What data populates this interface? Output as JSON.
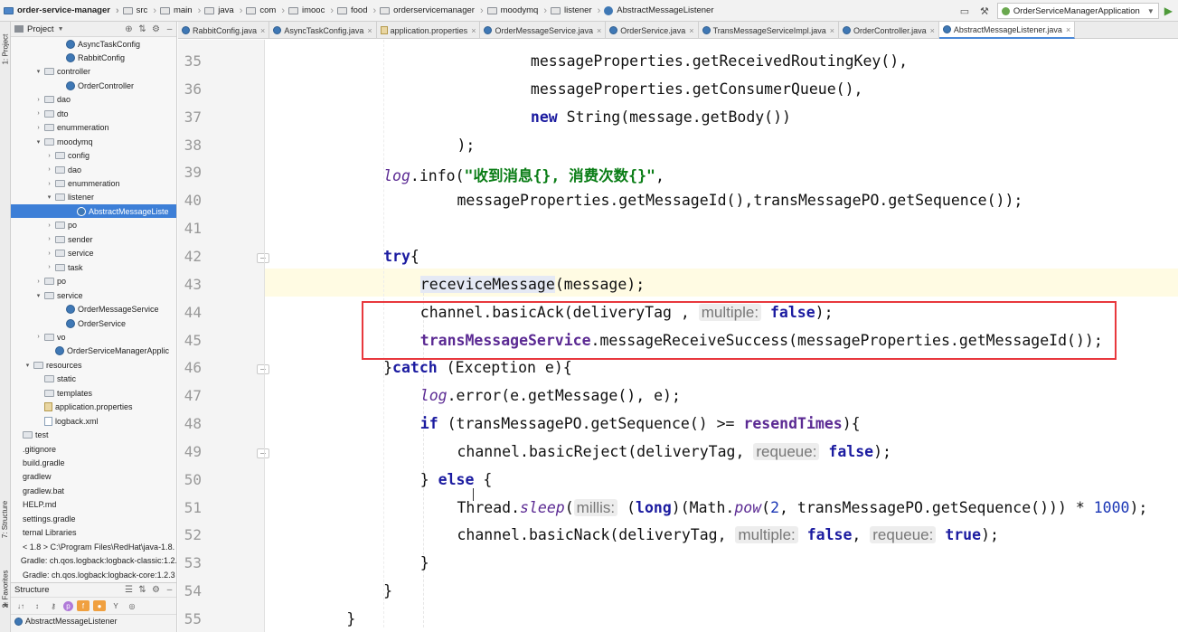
{
  "breadcrumb": [
    "order-service-manager",
    "src",
    "main",
    "java",
    "com",
    "imooc",
    "food",
    "orderservicemanager",
    "moodymq",
    "listener",
    "AbstractMessageListener"
  ],
  "run_config": "OrderServiceManagerApplication",
  "left_strip": {
    "project": "1: Project",
    "structure": "7: Structure",
    "favorites": "2: Favorites"
  },
  "project_panel": {
    "title": "Project",
    "tree": [
      {
        "label": "AsyncTaskConfig",
        "icon": "class",
        "indent": 4
      },
      {
        "label": "RabbitConfig",
        "icon": "class",
        "indent": 4
      },
      {
        "label": "controller",
        "icon": "folder",
        "arrow": "down",
        "indent": 2
      },
      {
        "label": "OrderController",
        "icon": "class",
        "indent": 4
      },
      {
        "label": "dao",
        "icon": "folder",
        "arrow": "right",
        "indent": 2
      },
      {
        "label": "dto",
        "icon": "folder",
        "arrow": "right",
        "indent": 2
      },
      {
        "label": "enummeration",
        "icon": "folder",
        "arrow": "right",
        "indent": 2
      },
      {
        "label": "moodymq",
        "icon": "folder",
        "arrow": "down",
        "indent": 2
      },
      {
        "label": "config",
        "icon": "folder",
        "arrow": "right",
        "indent": 3
      },
      {
        "label": "dao",
        "icon": "folder",
        "arrow": "right",
        "indent": 3
      },
      {
        "label": "enummeration",
        "icon": "folder",
        "arrow": "right",
        "indent": 3
      },
      {
        "label": "listener",
        "icon": "folder",
        "arrow": "down",
        "indent": 3
      },
      {
        "label": "AbstractMessageListe",
        "icon": "class",
        "indent": 5,
        "selected": true
      },
      {
        "label": "po",
        "icon": "folder",
        "arrow": "right",
        "indent": 3
      },
      {
        "label": "sender",
        "icon": "folder",
        "arrow": "right",
        "indent": 3
      },
      {
        "label": "service",
        "icon": "folder",
        "arrow": "right",
        "indent": 3
      },
      {
        "label": "task",
        "icon": "folder",
        "arrow": "right",
        "indent": 3
      },
      {
        "label": "po",
        "icon": "folder",
        "arrow": "right",
        "indent": 2
      },
      {
        "label": "service",
        "icon": "folder",
        "arrow": "down",
        "indent": 2
      },
      {
        "label": "OrderMessageService",
        "icon": "class",
        "indent": 4
      },
      {
        "label": "OrderService",
        "icon": "class",
        "indent": 4
      },
      {
        "label": "vo",
        "icon": "folder",
        "arrow": "right",
        "indent": 2
      },
      {
        "label": "OrderServiceManagerApplic",
        "icon": "class",
        "indent": 3
      },
      {
        "label": "resources",
        "icon": "folder",
        "arrow": "down",
        "indent": 1
      },
      {
        "label": "static",
        "icon": "folder",
        "indent": 2
      },
      {
        "label": "templates",
        "icon": "folder",
        "indent": 2
      },
      {
        "label": "application.properties",
        "icon": "props",
        "indent": 2
      },
      {
        "label": "logback.xml",
        "icon": "file",
        "indent": 2
      },
      {
        "label": "test",
        "icon": "folder",
        "indent": 0
      },
      {
        "label": ".gitignore",
        "icon": "none",
        "indent": 0
      },
      {
        "label": "build.gradle",
        "icon": "none",
        "indent": 0
      },
      {
        "label": "gradlew",
        "icon": "none",
        "indent": 0
      },
      {
        "label": "gradlew.bat",
        "icon": "none",
        "indent": 0
      },
      {
        "label": "HELP.md",
        "icon": "none",
        "indent": 0
      },
      {
        "label": "settings.gradle",
        "icon": "none",
        "indent": 0
      },
      {
        "label": "ternal Libraries",
        "icon": "none",
        "indent": 0
      },
      {
        "label": "< 1.8 >  C:\\Program Files\\RedHat\\java-1.8.",
        "icon": "none",
        "indent": 0
      },
      {
        "label": "Gradle: ch.qos.logback:logback-classic:1.2.",
        "icon": "none",
        "indent": 0
      },
      {
        "label": "Gradle: ch.qos.logback:logback-core:1.2.3",
        "icon": "none",
        "indent": 0
      }
    ]
  },
  "structure_panel": {
    "title": "Structure",
    "item": "AbstractMessageListener"
  },
  "tabs": [
    {
      "label": "RabbitConfig.java",
      "icon": "class"
    },
    {
      "label": "AsyncTaskConfig.java",
      "icon": "class"
    },
    {
      "label": "application.properties",
      "icon": "props"
    },
    {
      "label": "OrderMessageService.java",
      "icon": "class"
    },
    {
      "label": "OrderService.java",
      "icon": "class"
    },
    {
      "label": "TransMessageServiceImpl.java",
      "icon": "class"
    },
    {
      "label": "OrderController.java",
      "icon": "class"
    },
    {
      "label": "AbstractMessageListener.java",
      "icon": "class",
      "active": true
    }
  ],
  "editor": {
    "lines": [
      {
        "n": 35,
        "indent": 7,
        "tokens": [
          {
            "t": "messageProperties.getReceivedRoutingKey(),"
          }
        ]
      },
      {
        "n": 36,
        "indent": 7,
        "tokens": [
          {
            "t": "messageProperties.getConsumerQueue(),"
          }
        ]
      },
      {
        "n": 37,
        "indent": 7,
        "tokens": [
          {
            "t": "new",
            "c": "kw"
          },
          {
            "t": " String(message.getBody())"
          }
        ]
      },
      {
        "n": 38,
        "indent": 5,
        "tokens": [
          {
            "t": ");"
          }
        ]
      },
      {
        "n": 39,
        "indent": 3,
        "tokens": [
          {
            "t": "log",
            "c": "it"
          },
          {
            "t": ".info("
          },
          {
            "t": "\"收到消息{}, 消费次数{}\"",
            "c": "str"
          },
          {
            "t": ","
          }
        ]
      },
      {
        "n": 40,
        "indent": 5,
        "tokens": [
          {
            "t": "messageProperties.getMessageId(),transMessagePO.getSequence());"
          }
        ]
      },
      {
        "n": 41,
        "indent": 0,
        "tokens": []
      },
      {
        "n": 42,
        "indent": 3,
        "tokens": [
          {
            "t": "try",
            "c": "kw"
          },
          {
            "t": "{"
          }
        ]
      },
      {
        "n": 43,
        "indent": 4,
        "tokens": [
          {
            "t": "receviceMessage",
            "c": "hl"
          },
          {
            "t": "(message);"
          }
        ]
      },
      {
        "n": 44,
        "indent": 4,
        "tokens": [
          {
            "t": "channel.basicAck(deliveryTag , "
          },
          {
            "t": "multiple:",
            "c": "hint"
          },
          {
            "t": " "
          },
          {
            "t": "false",
            "c": "kw"
          },
          {
            "t": ");"
          }
        ]
      },
      {
        "n": 45,
        "indent": 4,
        "tokens": [
          {
            "t": "transMessageService",
            "c": "fld"
          },
          {
            "t": ".messageReceiveSuccess(messageProperties.getMessageId());"
          }
        ]
      },
      {
        "n": 46,
        "indent": 3,
        "tokens": [
          {
            "t": "}"
          },
          {
            "t": "catch",
            "c": "kw"
          },
          {
            "t": " (Exception e){"
          }
        ]
      },
      {
        "n": 47,
        "indent": 4,
        "tokens": [
          {
            "t": "log",
            "c": "it"
          },
          {
            "t": ".error(e.getMessage(), e);"
          }
        ]
      },
      {
        "n": 48,
        "indent": 4,
        "tokens": [
          {
            "t": "if",
            "c": "kw"
          },
          {
            "t": " (transMessagePO.getSequence() >= "
          },
          {
            "t": "resendTimes",
            "c": "fld"
          },
          {
            "t": "){"
          }
        ]
      },
      {
        "n": 49,
        "indent": 5,
        "tokens": [
          {
            "t": "channel.basicReject(deliveryTag, "
          },
          {
            "t": "requeue:",
            "c": "hint"
          },
          {
            "t": " "
          },
          {
            "t": "false",
            "c": "kw"
          },
          {
            "t": ");"
          }
        ]
      },
      {
        "n": 50,
        "indent": 4,
        "tokens": [
          {
            "t": "} "
          },
          {
            "t": "else",
            "c": "kw"
          },
          {
            "t": " {"
          }
        ]
      },
      {
        "n": 51,
        "indent": 5,
        "tokens": [
          {
            "t": "Thread."
          },
          {
            "t": "sleep",
            "c": "it"
          },
          {
            "t": "("
          },
          {
            "t": "millis:",
            "c": "hint"
          },
          {
            "t": " ("
          },
          {
            "t": "long",
            "c": "kw"
          },
          {
            "t": ")(Math."
          },
          {
            "t": "pow",
            "c": "it"
          },
          {
            "t": "("
          },
          {
            "t": "2",
            "c": "num"
          },
          {
            "t": ", transMessagePO.getSequence())) * "
          },
          {
            "t": "1000",
            "c": "num"
          },
          {
            "t": ");"
          }
        ]
      },
      {
        "n": 52,
        "indent": 5,
        "tokens": [
          {
            "t": "channel.basicNack(deliveryTag, "
          },
          {
            "t": "multiple:",
            "c": "hint"
          },
          {
            "t": " "
          },
          {
            "t": "false",
            "c": "kw"
          },
          {
            "t": ", "
          },
          {
            "t": "requeue:",
            "c": "hint"
          },
          {
            "t": " "
          },
          {
            "t": "true",
            "c": "kw"
          },
          {
            "t": ");"
          }
        ]
      },
      {
        "n": 53,
        "indent": 4,
        "tokens": [
          {
            "t": "}"
          }
        ]
      },
      {
        "n": 54,
        "indent": 3,
        "tokens": [
          {
            "t": "}"
          }
        ]
      },
      {
        "n": 55,
        "indent": 2,
        "tokens": [
          {
            "t": "}"
          }
        ]
      }
    ]
  }
}
